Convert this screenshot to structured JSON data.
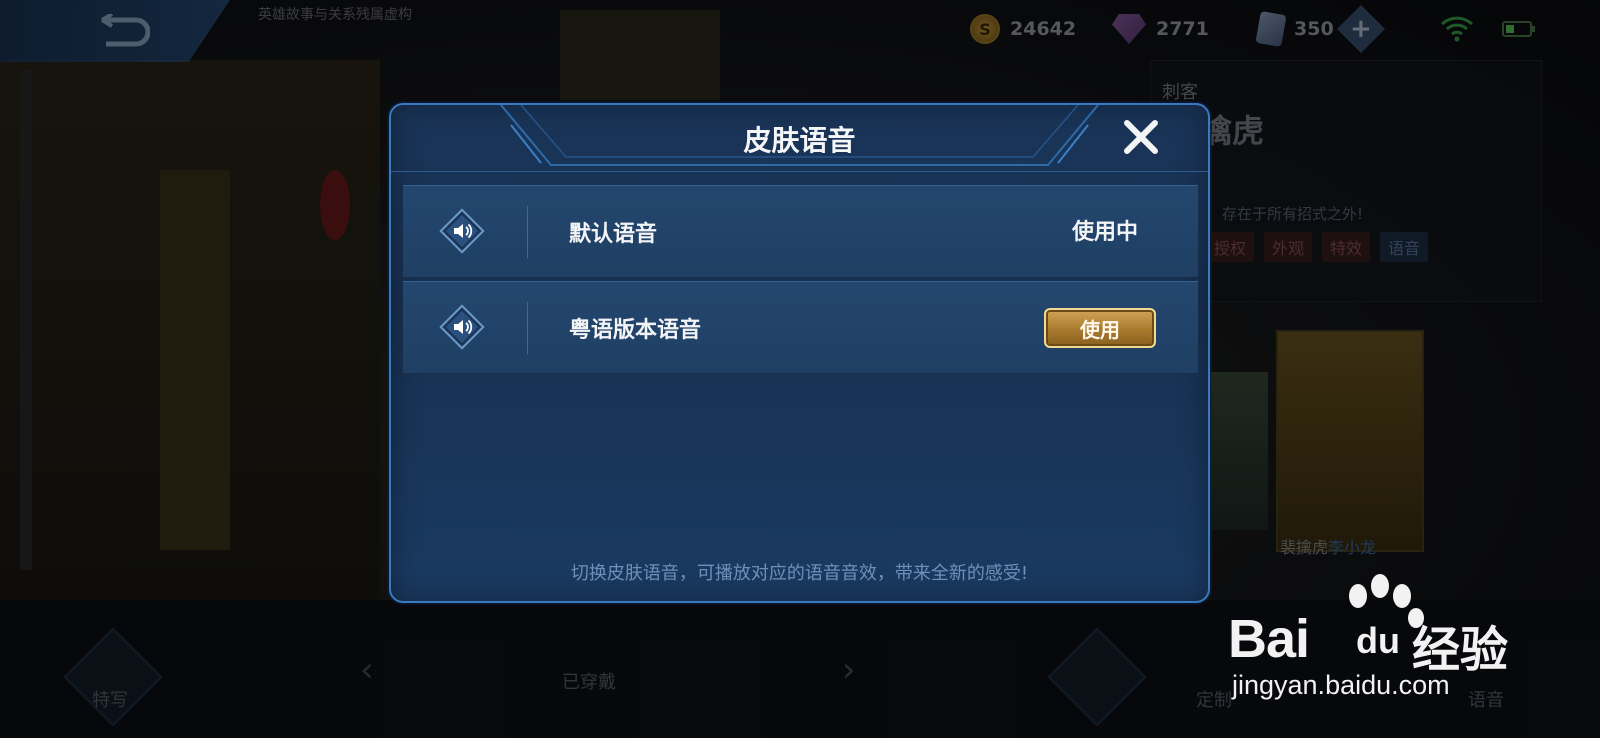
{
  "header": {
    "breadcrumb": "英雄故事与关系残属虚构",
    "resources": [
      {
        "name": "gold",
        "icon": "coin-icon",
        "value": "24642"
      },
      {
        "name": "diamond",
        "icon": "gem-icon",
        "value": "2771"
      },
      {
        "name": "voucher",
        "icon": "card-icon",
        "value": "350"
      }
    ],
    "coin_symbol": "S"
  },
  "background": {
    "role": "刺客",
    "hero_name": "擒虎",
    "hero_desc": "存在于所有招式之外!",
    "tags": [
      {
        "label": "授权",
        "style": "red"
      },
      {
        "label": "外观",
        "style": "red"
      },
      {
        "label": "特效",
        "style": "red"
      },
      {
        "label": "语音",
        "style": "blue"
      }
    ],
    "skin_name_prefix": "裴擒虎",
    "skin_name_highlight": "李小龙",
    "bottom": {
      "portrait": "特写",
      "worn": "已穿戴",
      "customize": "定制",
      "voice": "语音",
      "prev": "‹",
      "next": "›"
    }
  },
  "dialog": {
    "title": "皮肤语音",
    "close_symbol": "✕",
    "options": [
      {
        "name": "默认语音",
        "status": "使用中",
        "in_use": true
      },
      {
        "name": "粤语版本语音",
        "action": "使用",
        "in_use": false
      }
    ],
    "footer": "切换皮肤语音，可播放对应的语音音效，带来全新的感受!"
  },
  "watermark": {
    "brand_left": "Bai",
    "brand_mid": "du",
    "brand_cn": "经验",
    "url": "jingyan.baidu.com"
  },
  "colors": {
    "dialog_border": "#3a78c0",
    "button_gold": "#c89a4a",
    "text_muted": "#6e90b8"
  }
}
